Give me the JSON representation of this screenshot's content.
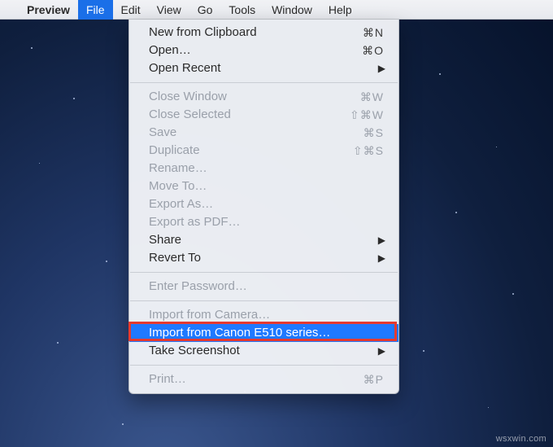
{
  "menubar": {
    "appname": "Preview",
    "items": [
      "File",
      "Edit",
      "View",
      "Go",
      "Tools",
      "Window",
      "Help"
    ],
    "active_index": 0
  },
  "dropdown": {
    "sections": [
      [
        {
          "label": "New from Clipboard",
          "shortcut": "⌘N",
          "enabled": true
        },
        {
          "label": "Open…",
          "shortcut": "⌘O",
          "enabled": true
        },
        {
          "label": "Open Recent",
          "submenu": true,
          "enabled": true
        }
      ],
      [
        {
          "label": "Close Window",
          "shortcut": "⌘W",
          "enabled": false
        },
        {
          "label": "Close Selected",
          "shortcut": "⇧⌘W",
          "enabled": false
        },
        {
          "label": "Save",
          "shortcut": "⌘S",
          "enabled": false
        },
        {
          "label": "Duplicate",
          "shortcut": "⇧⌘S",
          "enabled": false
        },
        {
          "label": "Rename…",
          "enabled": false
        },
        {
          "label": "Move To…",
          "enabled": false
        },
        {
          "label": "Export As…",
          "enabled": false
        },
        {
          "label": "Export as PDF…",
          "enabled": false
        },
        {
          "label": "Share",
          "submenu": true,
          "enabled": true
        },
        {
          "label": "Revert To",
          "submenu": true,
          "enabled": true
        }
      ],
      [
        {
          "label": "Enter Password…",
          "enabled": false
        }
      ],
      [
        {
          "label": "Import from Camera…",
          "enabled": false
        },
        {
          "label": "Import from Canon E510 series…",
          "enabled": true,
          "selected": true,
          "callout": true
        },
        {
          "label": "Take Screenshot",
          "submenu": true,
          "enabled": true
        }
      ],
      [
        {
          "label": "Print…",
          "shortcut": "⌘P",
          "enabled": false
        }
      ]
    ]
  },
  "watermark": "wsxwin.com"
}
